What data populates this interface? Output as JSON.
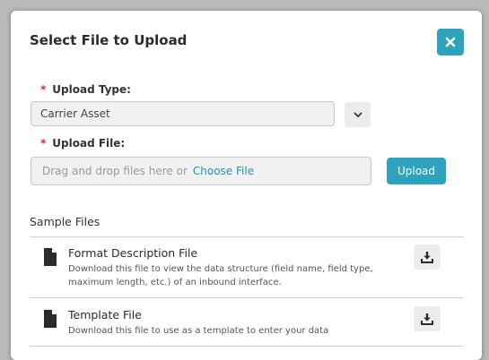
{
  "dialog": {
    "title": "Select File to Upload"
  },
  "upload_type": {
    "required_mark": "*",
    "label": "Upload Type:",
    "selected": "Carrier Asset"
  },
  "upload_file": {
    "required_mark": "*",
    "label": "Upload File:",
    "placeholder": "Drag and drop files here or",
    "choose_link": "Choose File",
    "upload_button": "Upload"
  },
  "sample_files": {
    "title": "Sample Files",
    "items": [
      {
        "name": "Format Description File",
        "description": "Download this file to view the data structure (field name, field type, maximum length, etc.) of an inbound interface."
      },
      {
        "name": "Template File",
        "description": "Download this file to use as a template to enter your data"
      }
    ]
  },
  "icons": {
    "close": "close-icon",
    "dropdown": "chevron-down-icon",
    "document": "document-icon",
    "download": "download-icon"
  },
  "colors": {
    "accent": "#2ea3bd",
    "required": "#d0312d",
    "link": "#2a8fb0"
  }
}
